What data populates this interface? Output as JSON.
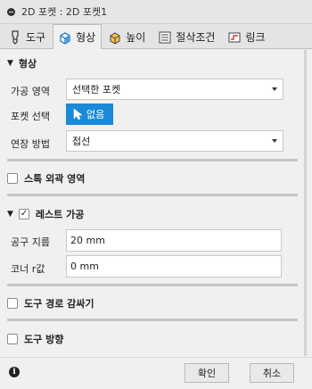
{
  "window": {
    "title": "2D 포켓 : 2D 포켓1"
  },
  "tabs": [
    {
      "label": "도구",
      "icon": "tool-icon"
    },
    {
      "label": "형상",
      "icon": "shape-cube-icon",
      "active": true
    },
    {
      "label": "높이",
      "icon": "height-cube-icon"
    },
    {
      "label": "절삭조건",
      "icon": "cutting-conditions-icon"
    },
    {
      "label": "링크",
      "icon": "link-icon"
    }
  ],
  "geometry": {
    "title": "형상",
    "machining_area_label": "가공 영역",
    "machining_area_value": "선택한 포켓",
    "pocket_select_label": "포켓 선택",
    "pocket_select_value": "없음",
    "extension_label": "연장 방법",
    "extension_value": "접선"
  },
  "stock_contour": {
    "title": "스톡 외곽 영역",
    "checked": false
  },
  "rest_machining": {
    "title": "레스트 가공",
    "checked": true,
    "tool_diameter_label": "공구 지름",
    "tool_diameter_value": "20 mm",
    "corner_radius_label": "코너 r값",
    "corner_radius_value": "0 mm"
  },
  "tool_containment": {
    "title": "도구 경로 감싸기",
    "checked": false
  },
  "tool_orientation": {
    "title": "도구 방향",
    "checked": false
  },
  "footer": {
    "ok_label": "확인",
    "cancel_label": "취소"
  },
  "colors": {
    "accent": "#1a8ad8"
  }
}
